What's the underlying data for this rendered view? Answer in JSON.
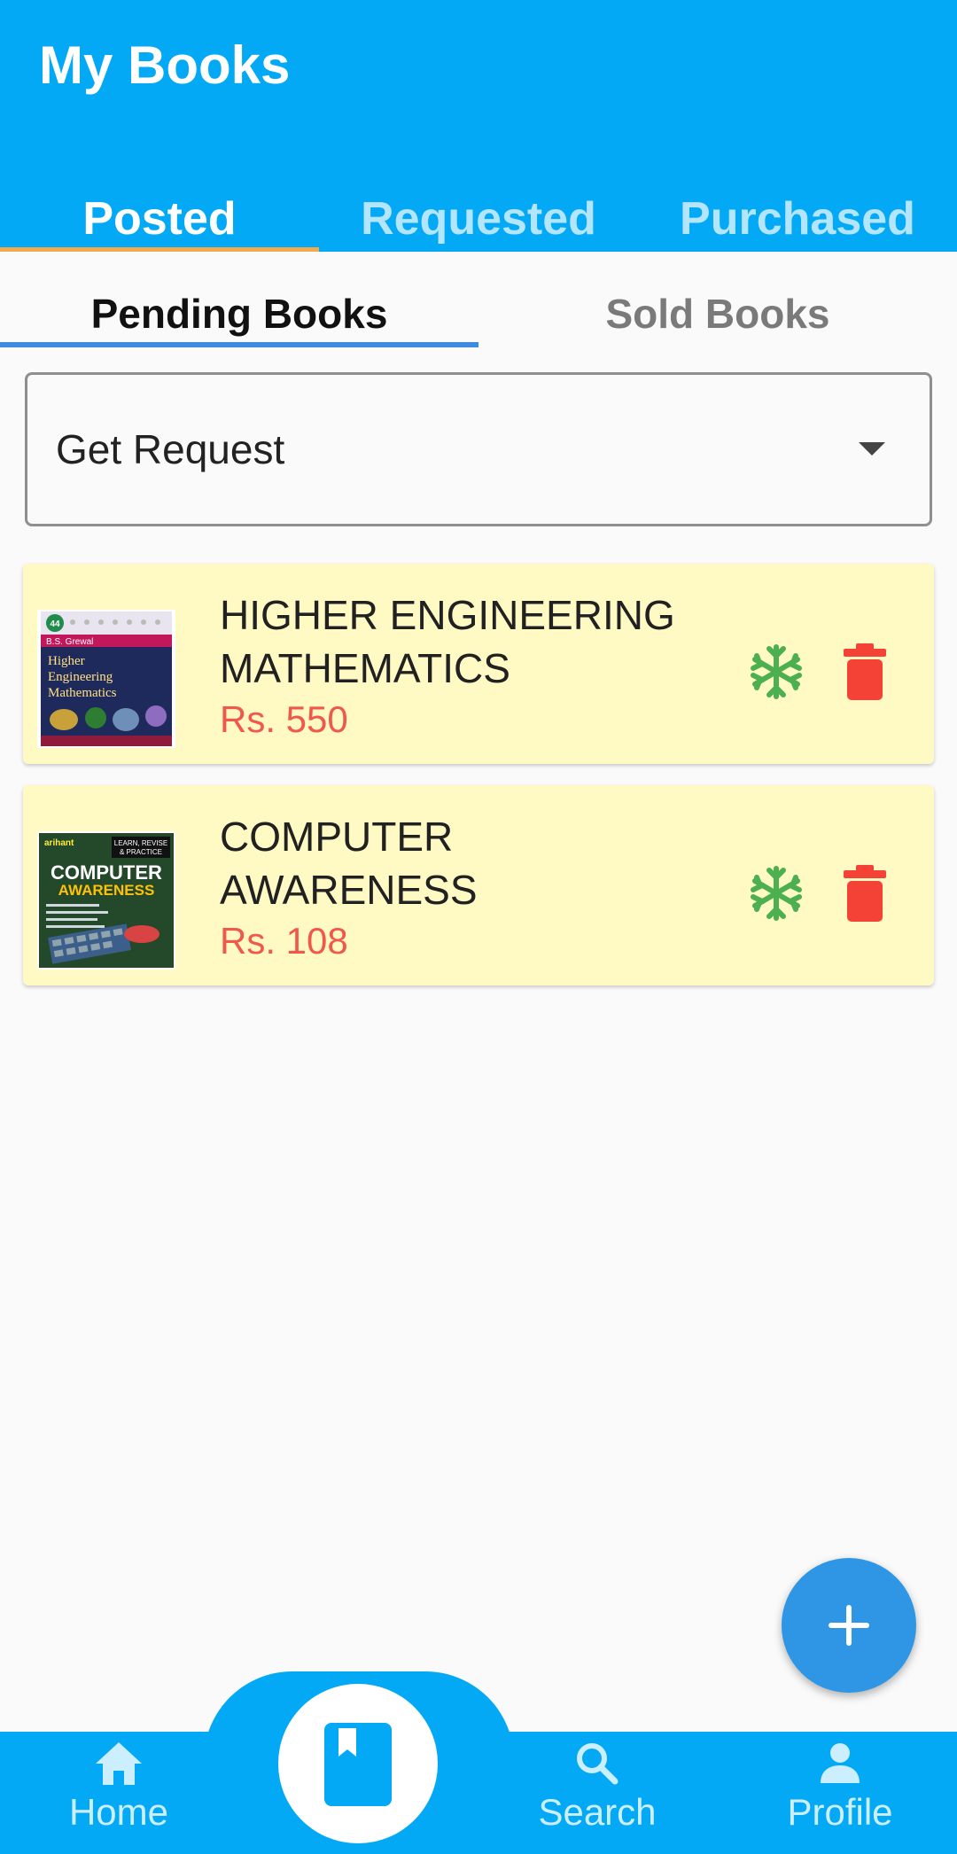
{
  "app_bar": {
    "title": "My Books"
  },
  "main_tabs": [
    {
      "label": "Posted",
      "active": true
    },
    {
      "label": "Requested",
      "active": false
    },
    {
      "label": "Purchased",
      "active": false
    }
  ],
  "sub_tabs": [
    {
      "label": "Pending Books",
      "active": true
    },
    {
      "label": "Sold Books",
      "active": false
    }
  ],
  "filter": {
    "selected": "Get Request",
    "icon": "dropdown-arrow-icon"
  },
  "books": [
    {
      "title_line1": "HIGHER ENGINEERING",
      "title_line2": "MATHEMATICS",
      "price": "Rs. 550",
      "cover": {
        "author": "B.S. Grewal",
        "line1": "Higher",
        "line2": "Engineering",
        "line3": "Mathematics",
        "edition": "44"
      }
    },
    {
      "title_line1": "COMPUTER",
      "title_line2": "AWARENESS",
      "price": "Rs. 108",
      "cover": {
        "publisher": "arihant",
        "tagline1": "LEARN, REVISE",
        "tagline2": "& PRACTICE",
        "line1": "COMPUTER",
        "line2": "AWARENESS"
      }
    }
  ],
  "fab": {
    "icon": "plus-icon"
  },
  "bottom_nav": {
    "home": "Home",
    "search": "Search",
    "profile": "Profile",
    "center_icon": "book-icon"
  },
  "colors": {
    "primary": "#03a9f4",
    "tab_indicator": "#f5a94e",
    "subtab_indicator": "#3d8be0",
    "card_bg": "#fff9c4",
    "price": "#f0584c",
    "freeze_icon": "#4caf50",
    "delete_icon": "#f44336",
    "fab": "#2f96e6"
  }
}
